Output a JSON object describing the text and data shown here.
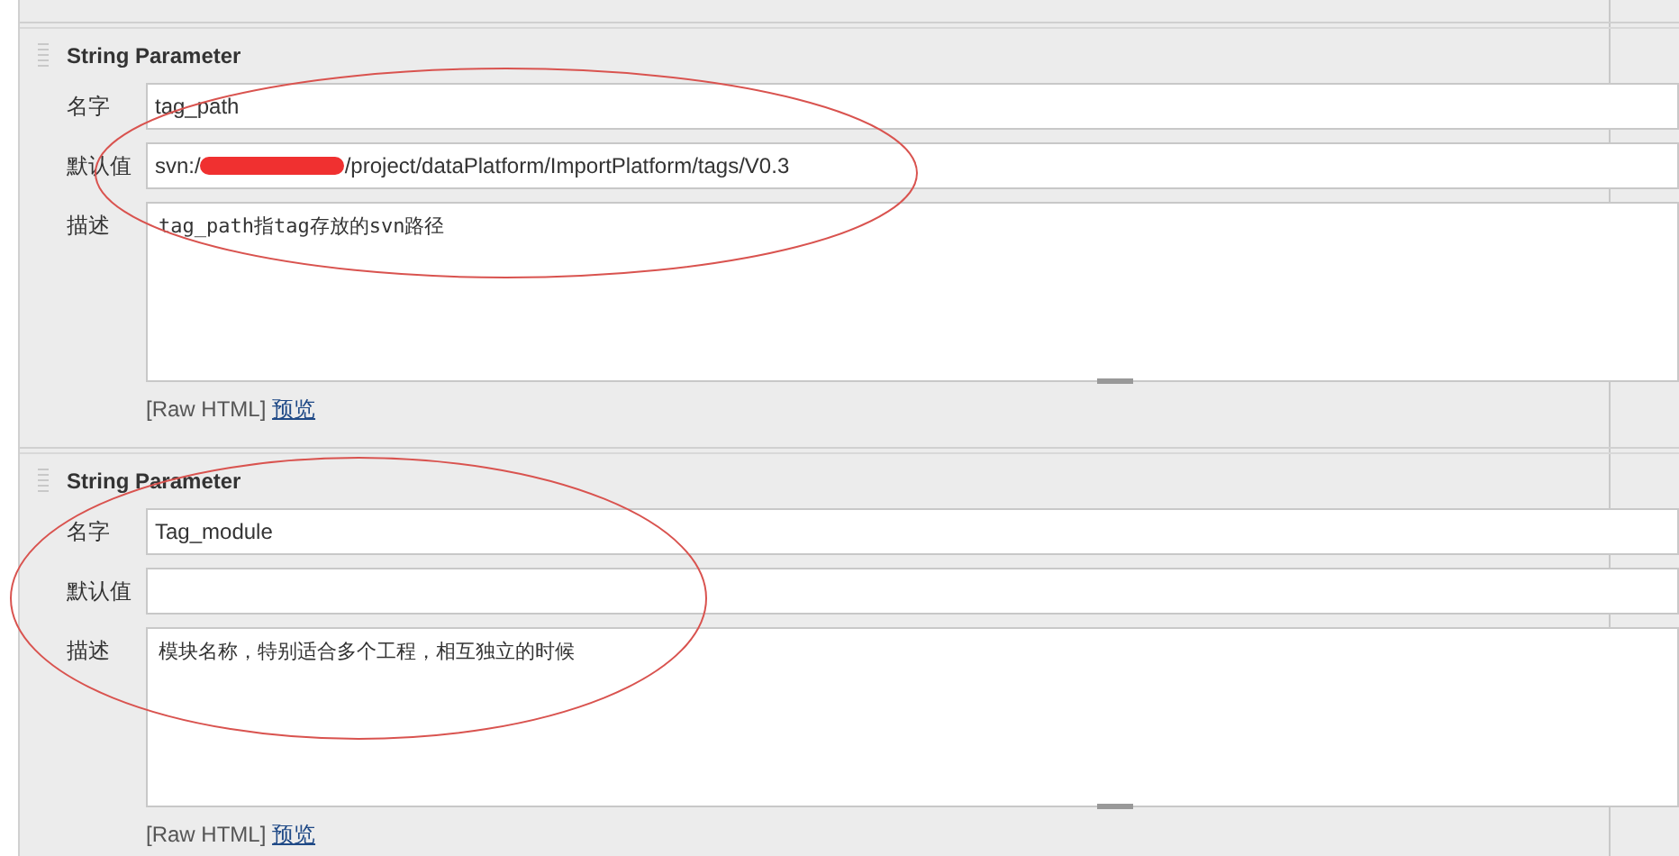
{
  "parameters": [
    {
      "title": "String Parameter",
      "highlighted": true,
      "name_label": "名字",
      "name_value": "tag_path",
      "default_label": "默认值",
      "default_value_before": "svn:/",
      "default_redacted": true,
      "default_value_after": "/project/dataPlatform/ImportPlatform/tags/V0.3",
      "description_label": "描述",
      "description": "tag_path指tag存放的svn路径",
      "raw_html": "[Raw HTML]",
      "preview_link": "预览"
    },
    {
      "title": "String Parameter",
      "highlighted": true,
      "name_label": "名字",
      "name_value": "Tag_module",
      "default_label": "默认值",
      "description_label": "描述",
      "description": "模块名称，特别适合多个工程，相互独立的时候",
      "raw_html": "[Raw HTML]",
      "preview_link": "预览"
    }
  ]
}
